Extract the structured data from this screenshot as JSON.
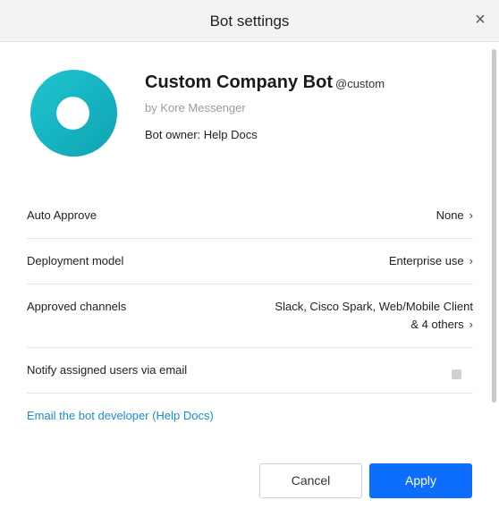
{
  "dialog": {
    "title": "Bot settings",
    "close_icon": "×"
  },
  "bot": {
    "name": "Custom Company Bot",
    "handle": "@custom",
    "by": "by Kore Messenger",
    "owner": "Bot owner: Help Docs",
    "logo_icon": "ring-logo-icon",
    "logo_color": "#1ab8c4"
  },
  "settings": {
    "auto_approve": {
      "label": "Auto Approve",
      "value": "None"
    },
    "deployment_model": {
      "label": "Deployment model",
      "value": "Enterprise use"
    },
    "approved_channels": {
      "label": "Approved channels",
      "value_line1": "Slack, Cisco Spark, Web/Mobile Client",
      "value_line2": "& 4 others"
    },
    "notify": {
      "label": "Notify assigned users via email"
    }
  },
  "email_link": "Email the bot developer (Help Docs)",
  "buttons": {
    "cancel": "Cancel",
    "apply": "Apply"
  },
  "chevron_icon": "›",
  "colors": {
    "accent": "#0d6efd",
    "link": "#1a8cd8",
    "header_bg": "#f3f3f3"
  }
}
